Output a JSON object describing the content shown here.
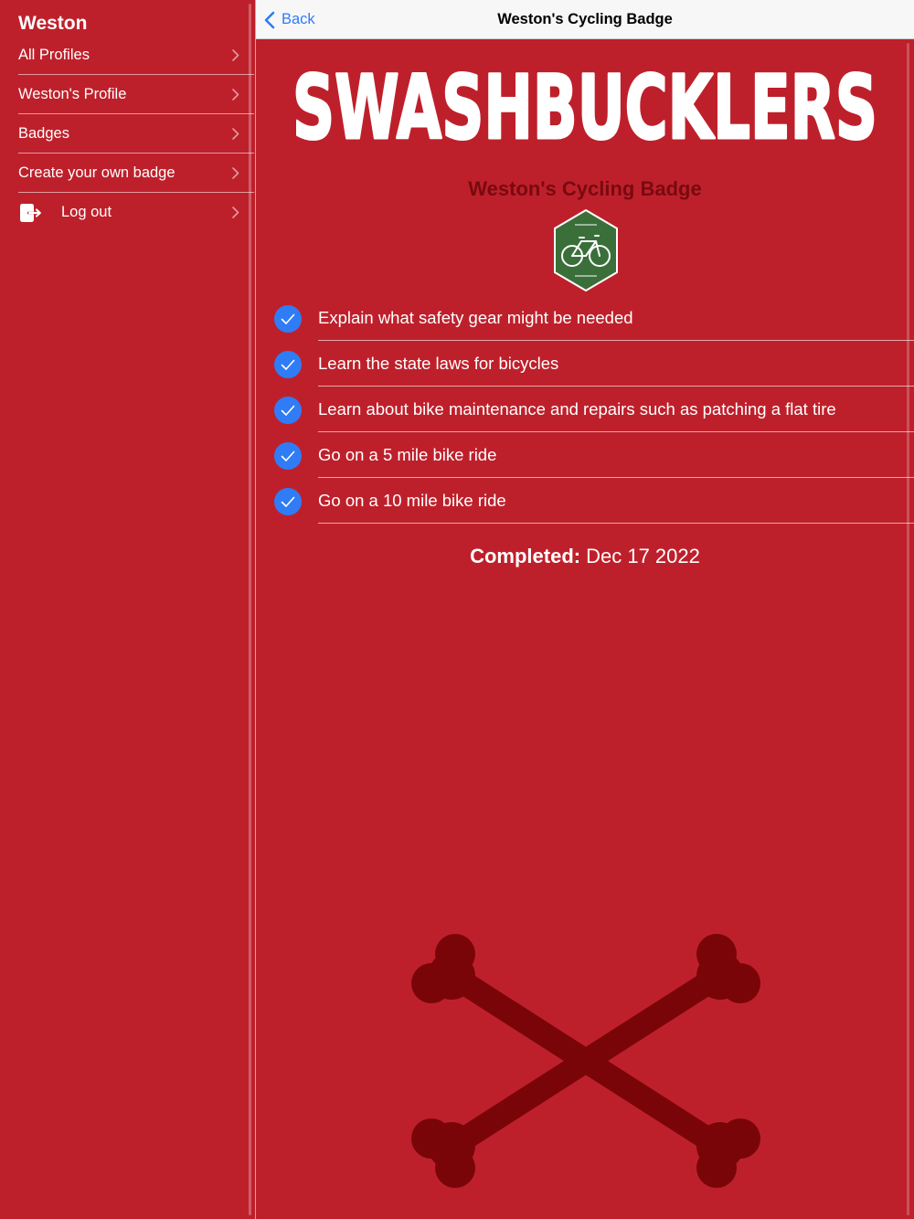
{
  "sidebar": {
    "user_name": "Weston",
    "items": [
      {
        "label": "All Profiles"
      },
      {
        "label": "Weston's Profile"
      },
      {
        "label": "Badges"
      },
      {
        "label": "Create your own badge"
      },
      {
        "label": "Log out",
        "icon": "logout-icon"
      }
    ]
  },
  "navbar": {
    "back_label": "Back",
    "title": "Weston's Cycling Badge"
  },
  "brand": {
    "logo_text": "SWASHBUCKLERS"
  },
  "badge": {
    "title": "Weston's Cycling Badge",
    "icon": "bicycle-icon",
    "requirements": [
      {
        "text": "Explain what safety gear might be needed",
        "checked": true
      },
      {
        "text": "Learn the state laws for bicycles",
        "checked": true
      },
      {
        "text": "Learn about bike maintenance and repairs such as patching a flat tire",
        "checked": true
      },
      {
        "text": "Go on a 5 mile bike ride",
        "checked": true
      },
      {
        "text": "Go on a 10 mile bike ride",
        "checked": true
      }
    ],
    "completed_label": "Completed:",
    "completed_date": "Dec 17 2022"
  },
  "colors": {
    "background": "#be202b",
    "badge_title": "#780a10",
    "badge_hex": "#3b6f3a",
    "check": "#2f7cf6",
    "link": "#2f7cf6",
    "crossbones": "#7a0508"
  }
}
